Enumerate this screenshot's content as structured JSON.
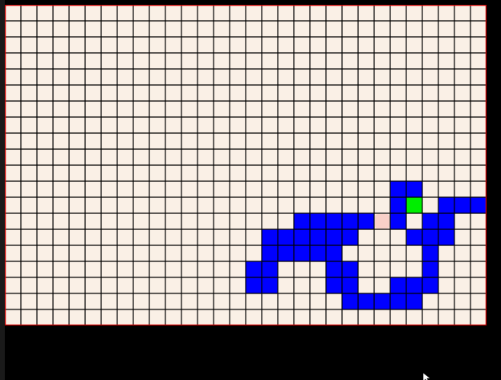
{
  "game": {
    "grid": {
      "cols": 30,
      "rows": 20
    },
    "colors": {
      "background": "#faf0e6",
      "grid_line": "#000000",
      "border": "#cc0000",
      "snake": "#0000ff",
      "head": "#00ee00",
      "food": "#f8d0c8"
    },
    "snake_cells": [
      [
        24,
        11
      ],
      [
        25,
        11
      ],
      [
        24,
        12
      ],
      [
        25,
        12
      ],
      [
        27,
        12
      ],
      [
        28,
        12
      ],
      [
        29,
        12
      ],
      [
        24,
        13
      ],
      [
        26,
        13
      ],
      [
        27,
        13
      ],
      [
        18,
        13
      ],
      [
        19,
        13
      ],
      [
        20,
        13
      ],
      [
        21,
        13
      ],
      [
        22,
        13
      ],
      [
        16,
        14
      ],
      [
        17,
        14
      ],
      [
        18,
        14
      ],
      [
        19,
        14
      ],
      [
        20,
        14
      ],
      [
        21,
        14
      ],
      [
        25,
        14
      ],
      [
        26,
        14
      ],
      [
        27,
        14
      ],
      [
        16,
        15
      ],
      [
        17,
        15
      ],
      [
        18,
        15
      ],
      [
        19,
        15
      ],
      [
        20,
        15
      ],
      [
        26,
        15
      ],
      [
        15,
        16
      ],
      [
        16,
        16
      ],
      [
        20,
        16
      ],
      [
        21,
        16
      ],
      [
        26,
        16
      ],
      [
        15,
        17
      ],
      [
        16,
        17
      ],
      [
        20,
        17
      ],
      [
        21,
        17
      ],
      [
        24,
        17
      ],
      [
        25,
        17
      ],
      [
        26,
        17
      ],
      [
        21,
        18
      ],
      [
        22,
        18
      ],
      [
        23,
        18
      ],
      [
        24,
        18
      ],
      [
        25,
        18
      ]
    ],
    "head_cell": [
      25,
      12
    ],
    "food_cell": [
      23,
      13
    ],
    "cursor_icon": "mouse-pointer-icon"
  }
}
